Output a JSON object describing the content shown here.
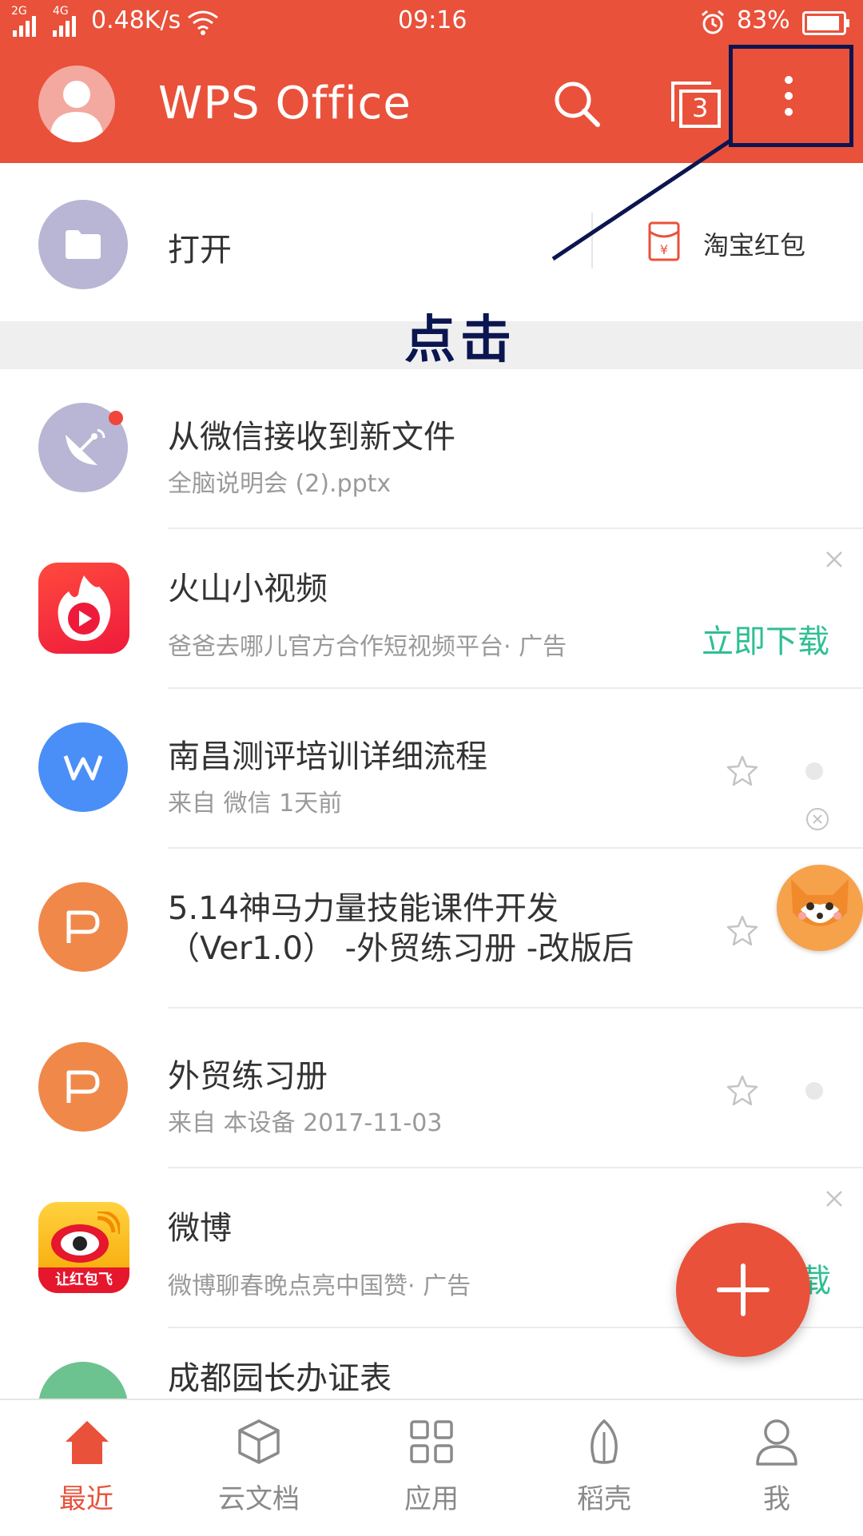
{
  "status_bar": {
    "signal_left": "2G",
    "signal_right": "4G",
    "speed": "0.48K/s",
    "time": "09:16",
    "battery": "83%"
  },
  "header": {
    "title": "WPS Office",
    "tab_count": "3"
  },
  "open_row": {
    "label": "打开",
    "promo": "淘宝红包"
  },
  "annotation": {
    "text": "点击"
  },
  "files": [
    {
      "title": "从微信接收到新文件",
      "sub": "全脑说明会 (2).pptx"
    },
    {
      "title": "火山小视频",
      "sub": "爸爸去哪儿官方合作短视频平台· 广告",
      "action": "立即下载"
    },
    {
      "title": "南昌测评培训详细流程",
      "sub": "来自 微信   1天前"
    },
    {
      "title": "5.14神马力量技能课件开发",
      "title2": "（Ver1.0） -外贸练习册 -改版后"
    },
    {
      "title": "外贸练习册",
      "sub": "来自 本设备   2017-11-03"
    },
    {
      "title": "微博",
      "sub": "微博聊春晚点亮中国赞· 广告",
      "action": "载"
    },
    {
      "title": "成都园长办证表"
    }
  ],
  "weibo_badge": "让红包飞",
  "bottom_nav": [
    {
      "label": "最近",
      "icon": "home-icon"
    },
    {
      "label": "云文档",
      "icon": "cube-icon"
    },
    {
      "label": "应用",
      "icon": "grid-icon"
    },
    {
      "label": "稻壳",
      "icon": "leaf-icon"
    },
    {
      "label": "我",
      "icon": "person-icon"
    }
  ],
  "colors": {
    "brand": "#e9513a",
    "accent_green": "#2fbf93",
    "annotation": "#0b1550"
  }
}
